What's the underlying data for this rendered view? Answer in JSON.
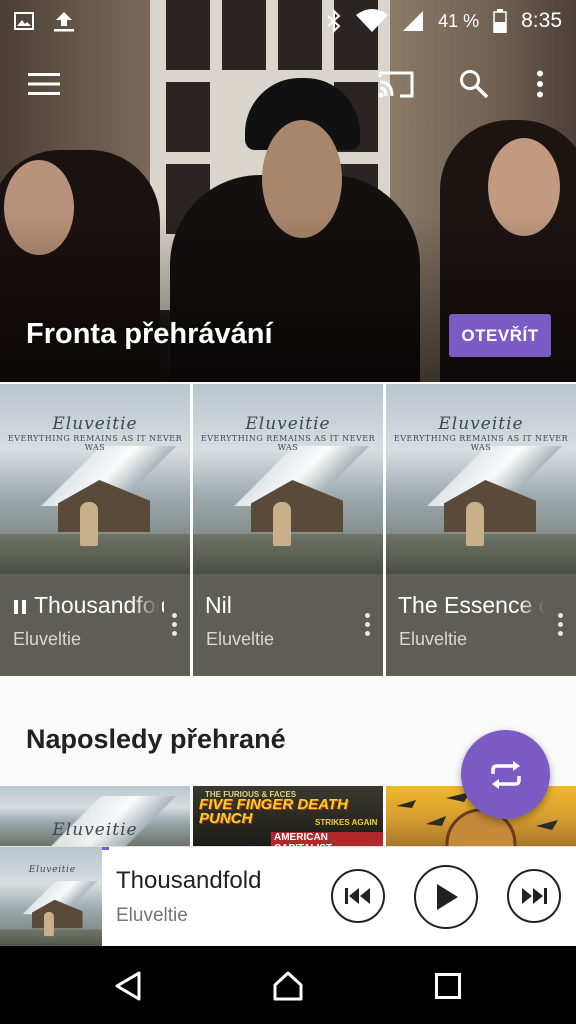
{
  "status_bar": {
    "battery_percent": "41 %",
    "time": "8:35",
    "icons": [
      "image-icon",
      "upload-icon",
      "bluetooth-icon",
      "wifi-icon",
      "signal-icon",
      "battery-icon"
    ]
  },
  "toolbar": {
    "icons": [
      "menu-icon",
      "cast-icon",
      "search-icon",
      "more-vert-icon"
    ]
  },
  "hero": {
    "title": "Fronta přehrávání",
    "open_button": "OTEVŘÍT"
  },
  "album_art": {
    "band_logo": "Eluveitie",
    "album_subtitle": "EVERYTHING REMAINS AS IT NEVER WAS"
  },
  "queue": [
    {
      "title": "Thousandfold",
      "artist": "Eluveltie",
      "playing": true
    },
    {
      "title": "Nil",
      "artist": "Eluveltie",
      "playing": false
    },
    {
      "title": "The Essence of Ashes",
      "artist": "Eluveltie",
      "playing": false
    }
  ],
  "recent": {
    "title": "Naposledy přehrané",
    "tiles": [
      {
        "label": "Eluveitie"
      },
      {
        "label": "FIVE FINGER DEATH PUNCH",
        "sub": "AMERICAN CAPITALIST",
        "top": "THE FURIOUS & FACES",
        "badge": "STRIKES AGAIN"
      },
      {
        "label": ""
      }
    ]
  },
  "mini_player": {
    "title": "Thousandfold",
    "artist": "Eluveltie",
    "progress": 0.19
  },
  "colors": {
    "accent": "#7b5cc4",
    "card_meta_bg": "#5e5e56"
  }
}
